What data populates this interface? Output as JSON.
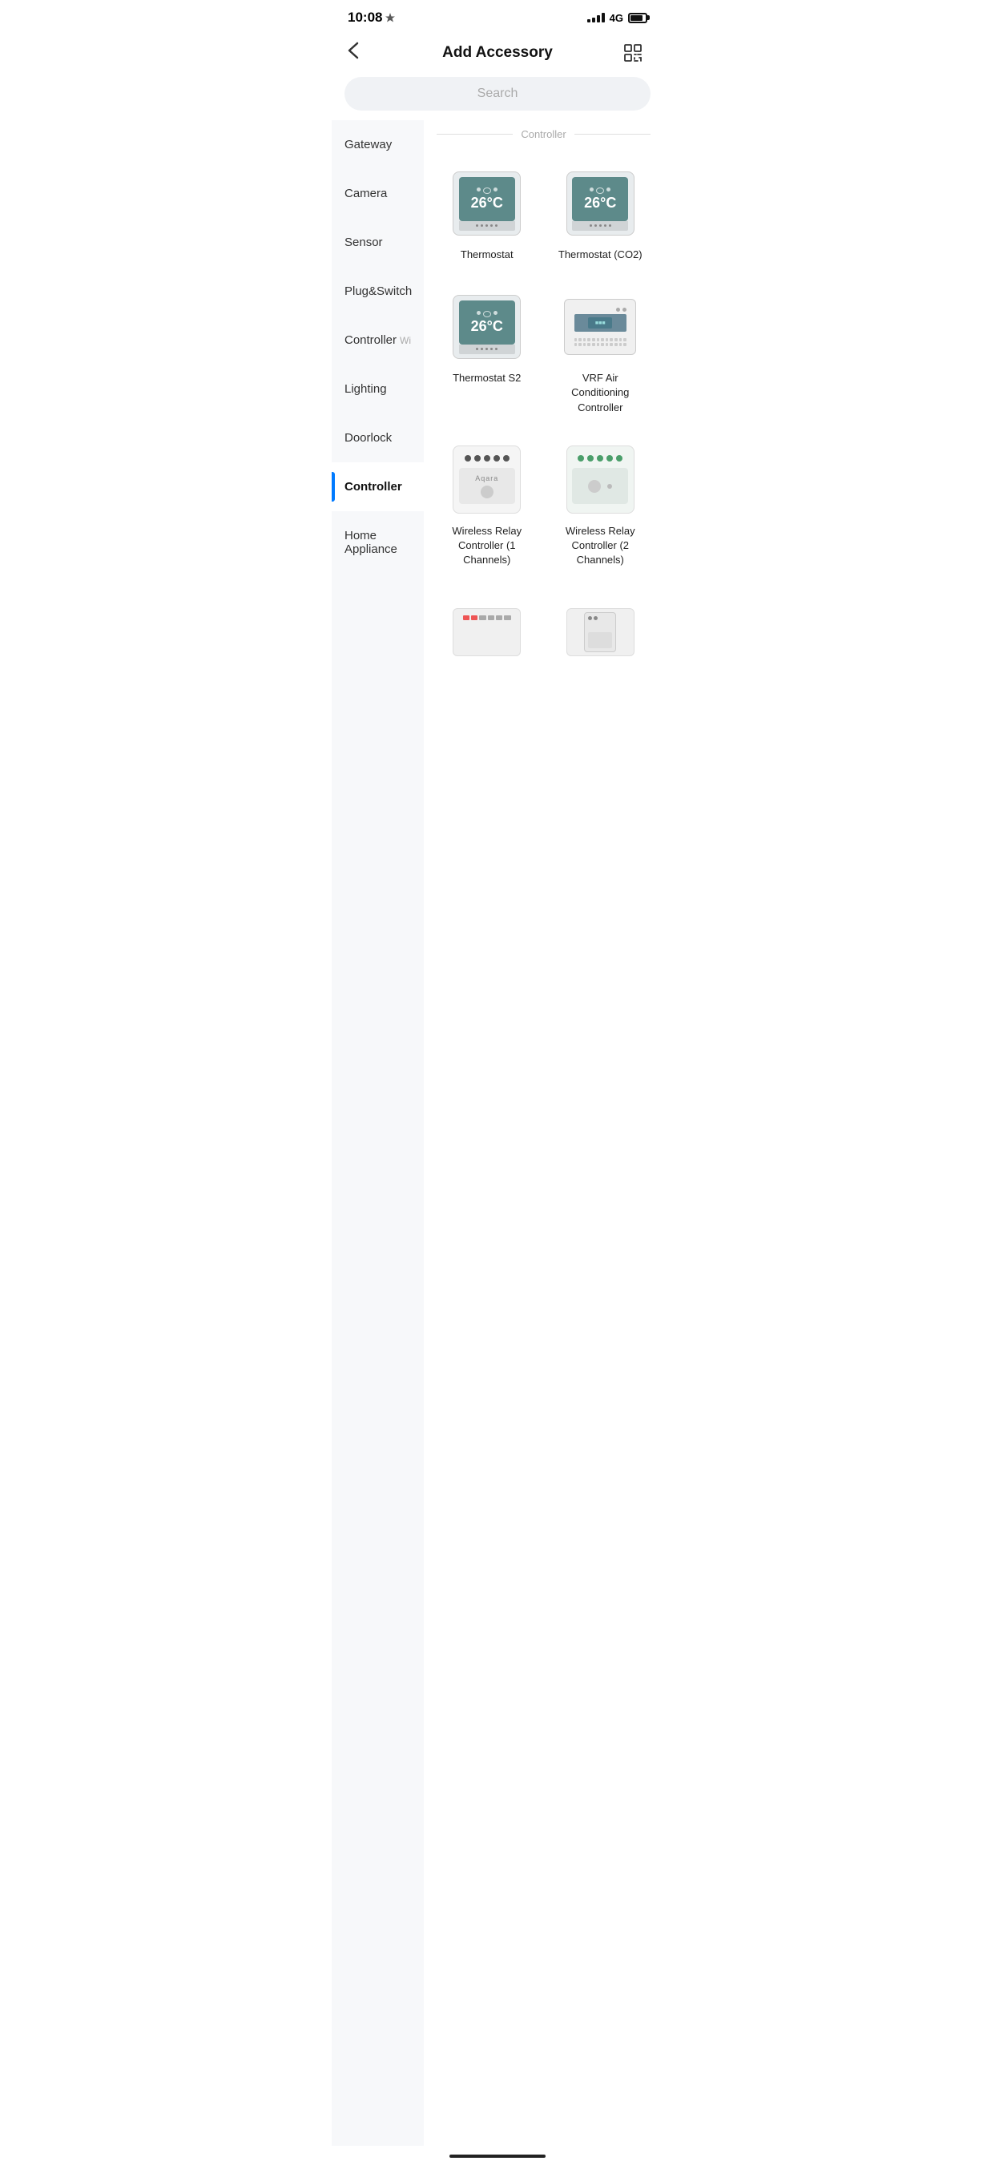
{
  "statusBar": {
    "time": "10:08",
    "signal": "4G"
  },
  "header": {
    "title": "Add Accessory",
    "backLabel": "‹",
    "scanLabel": "scan"
  },
  "search": {
    "placeholder": "Search"
  },
  "sidebar": {
    "items": [
      {
        "id": "gateway",
        "label": "Gateway",
        "active": false
      },
      {
        "id": "camera",
        "label": "Camera",
        "active": false
      },
      {
        "id": "sensor",
        "label": "Sensor",
        "active": false
      },
      {
        "id": "plug-switch",
        "label": "Plug&Switch",
        "active": false
      },
      {
        "id": "controller-sub",
        "label": "Controller",
        "active": false
      },
      {
        "id": "lighting",
        "label": "Lighting",
        "active": false
      },
      {
        "id": "doorlock",
        "label": "Doorlock",
        "active": false
      },
      {
        "id": "controller",
        "label": "Controller",
        "active": true
      },
      {
        "id": "home-appliance",
        "label": "Home Appliance",
        "active": false
      }
    ]
  },
  "content": {
    "sectionLabel": "Controller",
    "subSectionLabel": "Wi",
    "products": [
      {
        "id": "thermostat",
        "name": "Thermostat",
        "type": "thermostat",
        "temp": "26°C"
      },
      {
        "id": "thermostat-co2",
        "name": "Thermostat (CO2)",
        "type": "thermostat",
        "temp": "26°C"
      },
      {
        "id": "thermostat-s2",
        "name": "Thermostat S2",
        "type": "thermostat",
        "temp": "26°C"
      },
      {
        "id": "vrf-ac",
        "name": "VRF Air Conditioning Controller",
        "type": "vrf"
      },
      {
        "id": "relay-1ch",
        "name": "Wireless Relay Controller (1 Channels)",
        "type": "relay1"
      },
      {
        "id": "relay-2ch",
        "name": "Wireless Relay Controller (2 Channels)",
        "type": "relay2"
      }
    ]
  }
}
